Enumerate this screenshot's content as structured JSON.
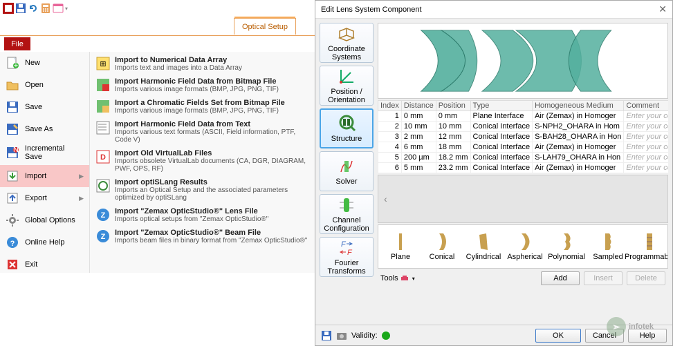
{
  "left": {
    "ribbon_active_tab": "Optical Setup",
    "file_tab": "File",
    "menu": [
      {
        "id": "new",
        "label": "New",
        "icon": "new"
      },
      {
        "id": "open",
        "label": "Open",
        "icon": "open"
      },
      {
        "id": "save",
        "label": "Save",
        "icon": "save"
      },
      {
        "id": "saveas",
        "label": "Save As",
        "icon": "saveas"
      },
      {
        "id": "incsave",
        "label": "Incremental Save",
        "icon": "incsave"
      },
      {
        "id": "import",
        "label": "Import",
        "icon": "import",
        "selected": true,
        "arrow": true
      },
      {
        "id": "export",
        "label": "Export",
        "icon": "export",
        "arrow": true
      },
      {
        "id": "globalopts",
        "label": "Global Options",
        "icon": "gear"
      },
      {
        "id": "help",
        "label": "Online Help",
        "icon": "help"
      },
      {
        "id": "exit",
        "label": "Exit",
        "icon": "exit"
      }
    ],
    "import_subitems": [
      {
        "title": "Import to Numerical Data Array",
        "desc": "Imports text and images into a Data Array"
      },
      {
        "title": "Import Harmonic Field Data from Bitmap File",
        "desc": "Imports various image formats (BMP, JPG, PNG, TIF)"
      },
      {
        "title": "Import a Chromatic Fields Set from Bitmap File",
        "desc": "Imports various image formats (BMP, JPG, PNG, TIF)"
      },
      {
        "title": "Import Harmonic Field Data from Text",
        "desc": "Imports various text formats (ASCII, Field information, PTF, Code V)"
      },
      {
        "title": "Import Old VirtualLab Files",
        "desc": "Imports obsolete VirtualLab documents (CA, DGR, DIAGRAM, PWF, OPS, RF)"
      },
      {
        "title": "Import optiSLang Results",
        "desc": "Imports an Optical Setup and the associated parameters optimized by optiSLang"
      },
      {
        "title": "Import \"Zemax OpticStudio®\" Lens File",
        "desc": "Imports optical setups from \"Zemax OpticStudio®\""
      },
      {
        "title": "Import \"Zemax OpticStudio®\" Beam File",
        "desc": "Imports beam files in binary format from \"Zemax OpticStudio®\""
      }
    ]
  },
  "dialog": {
    "title": "Edit Lens System Component",
    "side_buttons": [
      {
        "id": "coord",
        "label": "Coordinate Systems"
      },
      {
        "id": "posori",
        "label": "Position / Orientation"
      },
      {
        "id": "structure",
        "label": "Structure",
        "selected": true
      },
      {
        "id": "solver",
        "label": "Solver"
      },
      {
        "id": "chancfg",
        "label": "Channel Configuration"
      },
      {
        "id": "fourier",
        "label": "Fourier Transforms"
      }
    ],
    "table": {
      "headers": [
        "Index",
        "Distance",
        "Position",
        "Type",
        "Homogeneous Medium",
        "Comment"
      ],
      "rows": [
        {
          "index": "1",
          "distance": "0 mm",
          "position": "0 mm",
          "type": "Plane Interface",
          "medium": "Air (Zemax) in Homoger",
          "comment": "Enter your comm"
        },
        {
          "index": "2",
          "distance": "10 mm",
          "position": "10 mm",
          "type": "Conical Interface",
          "medium": "S-NPH2_OHARA in Hom",
          "comment": "Enter your comm"
        },
        {
          "index": "3",
          "distance": "2 mm",
          "position": "12 mm",
          "type": "Conical Interface",
          "medium": "S-BAH28_OHARA in Hon",
          "comment": "Enter your comm"
        },
        {
          "index": "4",
          "distance": "6 mm",
          "position": "18 mm",
          "type": "Conical Interface",
          "medium": "Air (Zemax) in Homoger",
          "comment": "Enter your comm"
        },
        {
          "index": "5",
          "distance": "200 µm",
          "position": "18.2 mm",
          "type": "Conical Interface",
          "medium": "S-LAH79_OHARA in Hon",
          "comment": "Enter your comm"
        },
        {
          "index": "6",
          "distance": "5 mm",
          "position": "23.2 mm",
          "type": "Conical Interface",
          "medium": "Air (Zemax) in Homoger",
          "comment": "Enter your comm"
        }
      ]
    },
    "blank_hint": "‹",
    "palette": [
      "Plane",
      "Conical",
      "Cylindrical",
      "Aspherical",
      "Polynomial",
      "Sampled",
      "Programmable"
    ],
    "tools_label": "Tools",
    "buttons": {
      "add": "Add",
      "insert": "Insert",
      "delete": "Delete",
      "ok": "OK",
      "cancel": "Cancel",
      "help": "Help"
    },
    "validity": "Validity:"
  },
  "watermark": "infotek"
}
